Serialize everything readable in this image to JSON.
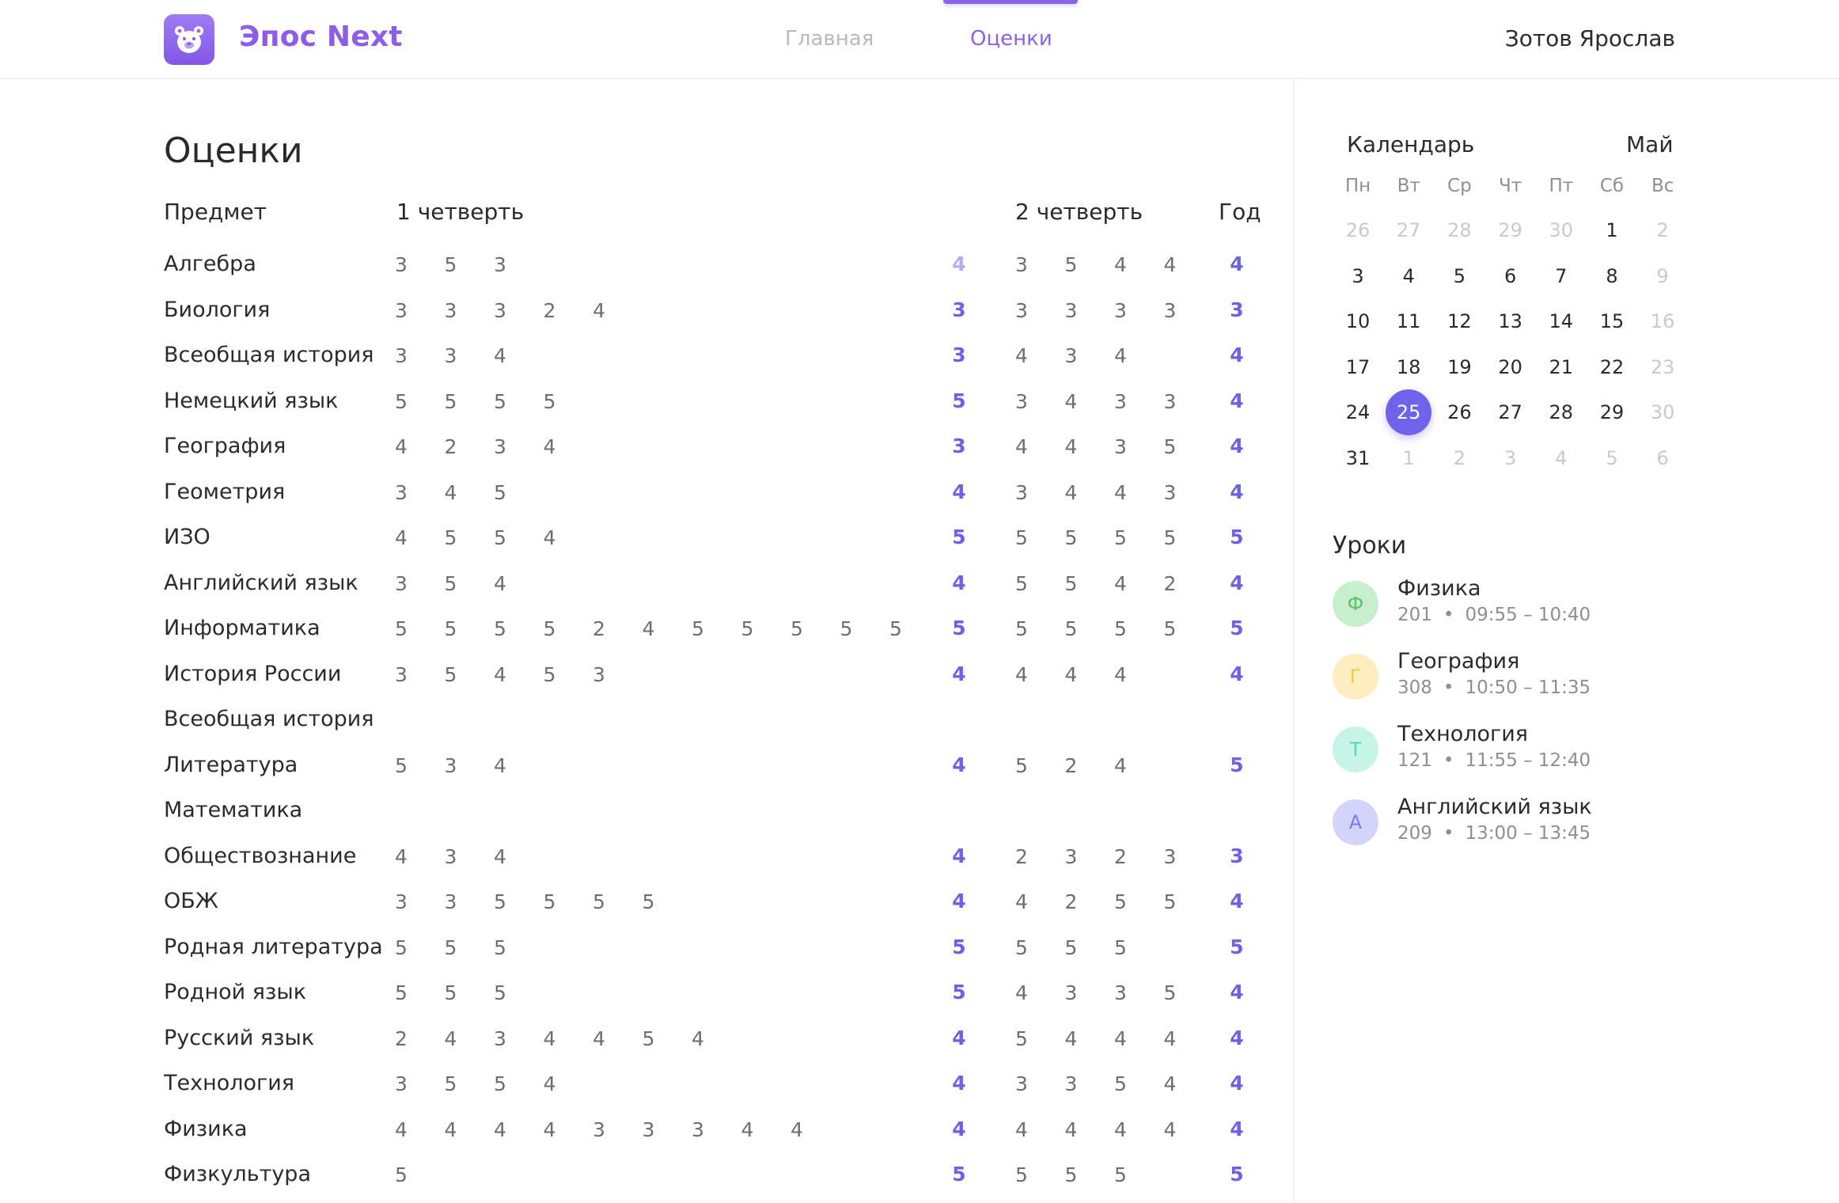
{
  "app": {
    "title": "Эпос Next"
  },
  "nav": {
    "home": "Главная",
    "grades": "Оценки",
    "active": "grades"
  },
  "user": {
    "name": "Зотов Ярослав"
  },
  "grades": {
    "title": "Оценки",
    "headers": {
      "subject": "Предмет",
      "q1": "1 четверть",
      "q2": "2 четверть",
      "year": "Год"
    },
    "rows": [
      {
        "subject": "Алгебра",
        "q1": [
          "3",
          "5",
          "3"
        ],
        "q1_avg": "4",
        "q1_avg_light": true,
        "q2": [
          "3",
          "5",
          "4",
          "4"
        ],
        "year": "4"
      },
      {
        "subject": "Биология",
        "q1": [
          "3",
          "3",
          "3",
          "2",
          "4"
        ],
        "q1_avg": "3",
        "q2": [
          "3",
          "3",
          "3",
          "3"
        ],
        "year": "3"
      },
      {
        "subject": "Всеобщая история",
        "q1": [
          "3",
          "3",
          "4"
        ],
        "q1_avg": "3",
        "q2": [
          "4",
          "3",
          "4"
        ],
        "year": "4"
      },
      {
        "subject": "Немецкий язык",
        "q1": [
          "5",
          "5",
          "5",
          "5"
        ],
        "q1_avg": "5",
        "q2": [
          "3",
          "4",
          "3",
          "3"
        ],
        "year": "4"
      },
      {
        "subject": "География",
        "q1": [
          "4",
          "2",
          "3",
          "4"
        ],
        "q1_avg": "3",
        "q2": [
          "4",
          "4",
          "3",
          "5"
        ],
        "year": "4"
      },
      {
        "subject": "Геометрия",
        "q1": [
          "3",
          "4",
          "5"
        ],
        "q1_avg": "4",
        "q2": [
          "3",
          "4",
          "4",
          "3"
        ],
        "year": "4"
      },
      {
        "subject": "ИЗО",
        "q1": [
          "4",
          "5",
          "5",
          "4"
        ],
        "q1_avg": "5",
        "q2": [
          "5",
          "5",
          "5",
          "5"
        ],
        "year": "5"
      },
      {
        "subject": "Английский язык",
        "q1": [
          "3",
          "5",
          "4"
        ],
        "q1_avg": "4",
        "q2": [
          "5",
          "5",
          "4",
          "2"
        ],
        "year": "4"
      },
      {
        "subject": "Информатика",
        "q1": [
          "5",
          "5",
          "5",
          "5",
          "2",
          "4",
          "5",
          "5",
          "5",
          "5",
          "5"
        ],
        "q1_avg": "5",
        "q2": [
          "5",
          "5",
          "5",
          "5"
        ],
        "year": "5"
      },
      {
        "subject": "История России",
        "q1": [
          "3",
          "5",
          "4",
          "5",
          "3"
        ],
        "q1_avg": "4",
        "q2": [
          "4",
          "4",
          "4"
        ],
        "year": "4"
      },
      {
        "subject": "Всеобщая история",
        "q1": [],
        "q1_avg": "",
        "q2": [],
        "year": ""
      },
      {
        "subject": "Литература",
        "q1": [
          "5",
          "3",
          "4"
        ],
        "q1_avg": "4",
        "q2": [
          "5",
          "2",
          "4"
        ],
        "year": "5"
      },
      {
        "subject": "Математика",
        "q1": [],
        "q1_avg": "",
        "q2": [],
        "year": ""
      },
      {
        "subject": "Обществознание",
        "q1": [
          "4",
          "3",
          "4"
        ],
        "q1_avg": "4",
        "q2": [
          "2",
          "3",
          "2",
          "3"
        ],
        "year": "3"
      },
      {
        "subject": "ОБЖ",
        "q1": [
          "3",
          "3",
          "5",
          "5",
          "5",
          "5"
        ],
        "q1_avg": "4",
        "q2": [
          "4",
          "2",
          "5",
          "5"
        ],
        "year": "4"
      },
      {
        "subject": "Родная литература",
        "q1": [
          "5",
          "5",
          "5"
        ],
        "q1_avg": "5",
        "q2": [
          "5",
          "5",
          "5"
        ],
        "year": "5"
      },
      {
        "subject": "Родной язык",
        "q1": [
          "5",
          "5",
          "5"
        ],
        "q1_avg": "5",
        "q2": [
          "4",
          "3",
          "3",
          "5"
        ],
        "year": "4"
      },
      {
        "subject": "Русский язык",
        "q1": [
          "2",
          "4",
          "3",
          "4",
          "4",
          "5",
          "4"
        ],
        "q1_avg": "4",
        "q2": [
          "5",
          "4",
          "4",
          "4"
        ],
        "year": "4"
      },
      {
        "subject": "Технология",
        "q1": [
          "3",
          "5",
          "5",
          "4"
        ],
        "q1_avg": "4",
        "q2": [
          "3",
          "3",
          "5",
          "4"
        ],
        "year": "4"
      },
      {
        "subject": "Физика",
        "q1": [
          "4",
          "4",
          "4",
          "4",
          "3",
          "3",
          "3",
          "4",
          "4"
        ],
        "q1_avg": "4",
        "q2": [
          "4",
          "4",
          "4",
          "4"
        ],
        "year": "4"
      },
      {
        "subject": "Физкультура",
        "q1": [
          "5"
        ],
        "q1_avg": "5",
        "q2": [
          "5",
          "5",
          "5"
        ],
        "year": "5"
      }
    ]
  },
  "calendar": {
    "title": "Календарь",
    "month": "Май",
    "weekdays": [
      "Пн",
      "Вт",
      "Ср",
      "Чт",
      "Пт",
      "Сб",
      "Вс"
    ],
    "weeks": [
      [
        {
          "d": "26",
          "m": true
        },
        {
          "d": "27",
          "m": true
        },
        {
          "d": "28",
          "m": true
        },
        {
          "d": "29",
          "m": true
        },
        {
          "d": "30",
          "m": true
        },
        {
          "d": "1"
        },
        {
          "d": "2",
          "m": true
        }
      ],
      [
        {
          "d": "3"
        },
        {
          "d": "4"
        },
        {
          "d": "5"
        },
        {
          "d": "6"
        },
        {
          "d": "7"
        },
        {
          "d": "8"
        },
        {
          "d": "9",
          "m": true
        }
      ],
      [
        {
          "d": "10"
        },
        {
          "d": "11"
        },
        {
          "d": "12"
        },
        {
          "d": "13"
        },
        {
          "d": "14"
        },
        {
          "d": "15"
        },
        {
          "d": "16",
          "m": true
        }
      ],
      [
        {
          "d": "17"
        },
        {
          "d": "18"
        },
        {
          "d": "19"
        },
        {
          "d": "20"
        },
        {
          "d": "21"
        },
        {
          "d": "22"
        },
        {
          "d": "23",
          "m": true
        }
      ],
      [
        {
          "d": "24"
        },
        {
          "d": "25",
          "t": true
        },
        {
          "d": "26"
        },
        {
          "d": "27"
        },
        {
          "d": "28"
        },
        {
          "d": "29"
        },
        {
          "d": "30",
          "m": true
        }
      ],
      [
        {
          "d": "31"
        },
        {
          "d": "1",
          "m": true
        },
        {
          "d": "2",
          "m": true
        },
        {
          "d": "3",
          "m": true
        },
        {
          "d": "4",
          "m": true
        },
        {
          "d": "5",
          "m": true
        },
        {
          "d": "6",
          "m": true
        }
      ]
    ]
  },
  "lessons": {
    "title": "Уроки",
    "items": [
      {
        "letter": "Ф",
        "name": "Физика",
        "room": "201",
        "time": "09:55 – 10:40",
        "bg": "#c8efcd",
        "fg": "#5cc26c"
      },
      {
        "letter": "Г",
        "name": "География",
        "room": "308",
        "time": "10:50 – 11:35",
        "bg": "#fdeec2",
        "fg": "#f0c550"
      },
      {
        "letter": "Т",
        "name": "Технология",
        "room": "121",
        "time": "11:55 – 12:40",
        "bg": "#c6f5e8",
        "fg": "#5fd6b3"
      },
      {
        "letter": "А",
        "name": "Английский язык",
        "room": "209",
        "time": "13:00 – 13:45",
        "bg": "#d4d3fb",
        "fg": "#7c78ea"
      }
    ]
  },
  "colors": {
    "accent": "#8a63ea",
    "avg": "#6d61e8",
    "today": "#6e63ea"
  },
  "icons": {
    "logo": "bear-icon"
  }
}
